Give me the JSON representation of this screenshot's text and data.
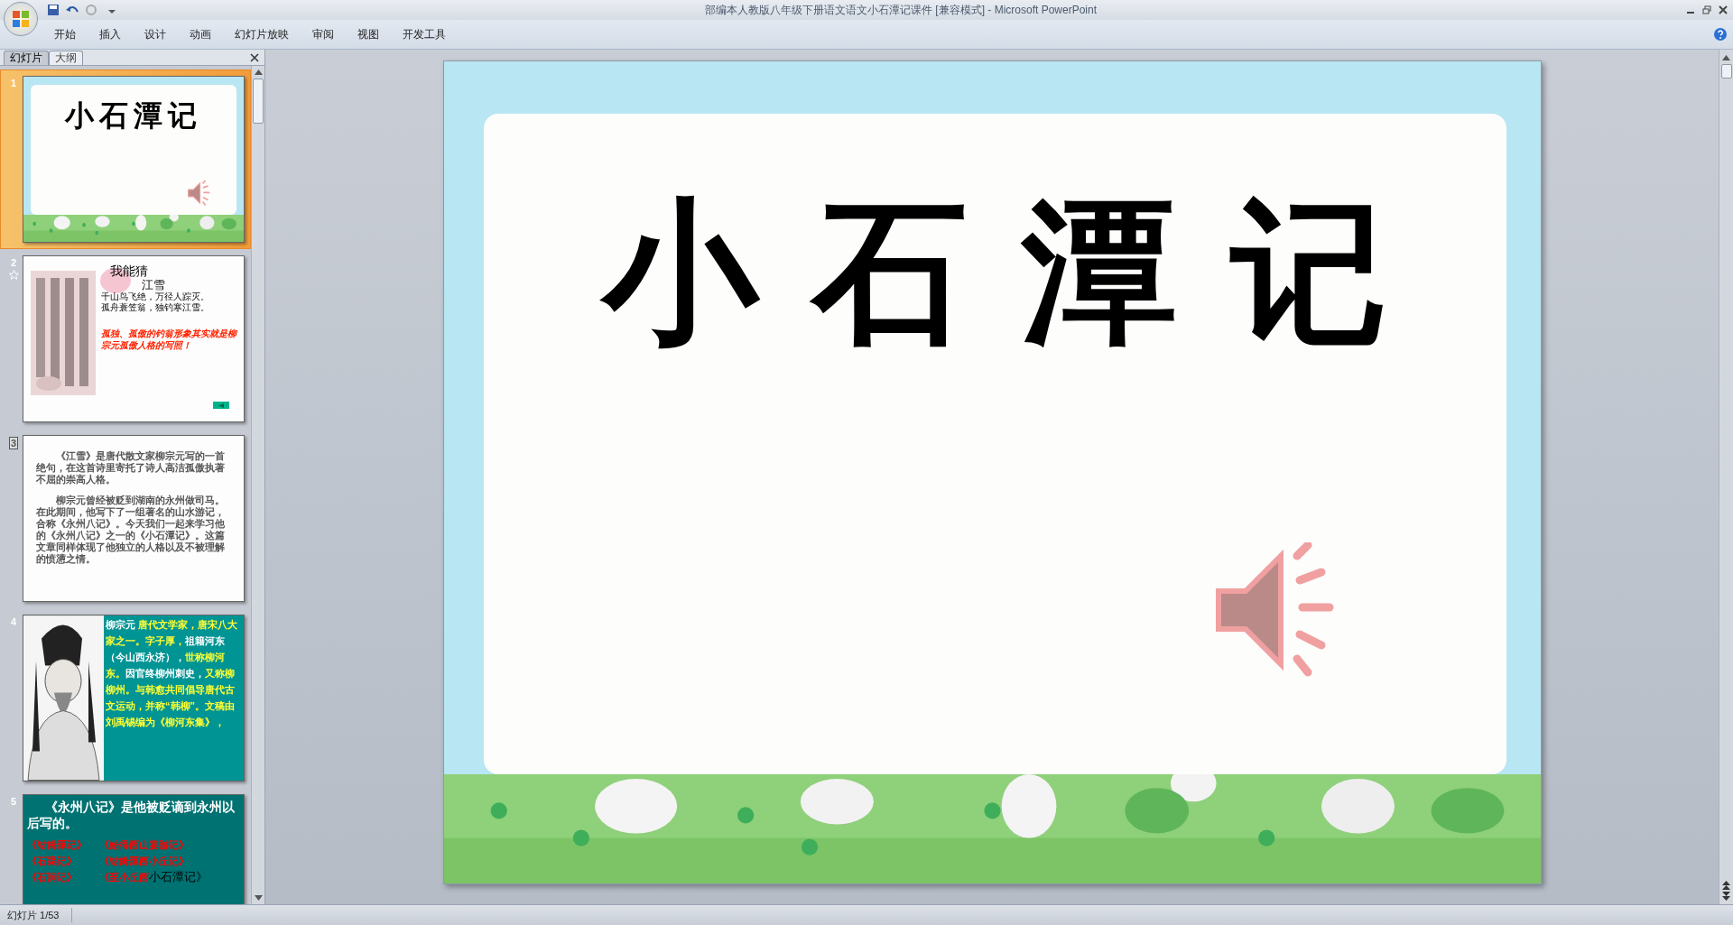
{
  "window": {
    "title": "部编本人教版八年级下册语文语文小石潭记课件 [兼容模式] - Microsoft PowerPoint"
  },
  "ribbon_tabs": [
    "开始",
    "插入",
    "设计",
    "动画",
    "幻灯片放映",
    "审阅",
    "视图",
    "开发工具"
  ],
  "panel_tabs": [
    {
      "label": "幻灯片",
      "selected": true
    },
    {
      "label": "大纲",
      "selected": false
    }
  ],
  "thumbnails": [
    {
      "number": "1",
      "kind": "title",
      "selected": true,
      "animated": false,
      "hidden": false,
      "title": "小石潭记"
    },
    {
      "number": "2",
      "kind": "poem",
      "selected": false,
      "animated": true,
      "hidden": false,
      "heading": "我能猜",
      "poem_title": "江雪",
      "lines": [
        "千山鸟飞绝，万径人踪灭。",
        "孤舟蓑笠翁，独钓寒江雪。"
      ],
      "comment": "孤独、孤傲的钓翁形象其实就是柳宗元孤傲人格的写照！"
    },
    {
      "number": "3",
      "kind": "prose",
      "selected": false,
      "animated": false,
      "hidden": true,
      "paragraphs": [
        "《江雪》是唐代散文家柳宗元写的一首绝句，在这首诗里寄托了诗人高洁孤傲执著不屈的崇高人格。",
        "柳宗元曾经被贬到湖南的永州做司马。在此期间，他写下了一组著名的山水游记，合称《永州八记》。今天我们一起来学习他的《永州八记》之一的《小石潭记》。这篇文章同样体现了他独立的人格以及不被理解的愤懑之情。"
      ]
    },
    {
      "number": "4",
      "kind": "bio",
      "selected": false,
      "animated": false,
      "hidden": false,
      "segments": [
        {
          "text": "柳宗元 ",
          "color": "#ffffff"
        },
        {
          "text": "唐代文学家，唐宋八大家之一。字子厚，",
          "color": "#ffff33"
        },
        {
          "text": "祖籍河东（今山西永济），",
          "color": "#ffffff"
        },
        {
          "text": "世称柳河东。",
          "color": "#ffff33"
        },
        {
          "text": "因官终柳州刺史，",
          "color": "#ffffff"
        },
        {
          "text": "又称柳柳州。与韩愈共同倡导唐代古文运动，并称“韩柳”。文稿由刘禹锡编为《柳河东集》，",
          "color": "#ffff33"
        }
      ]
    },
    {
      "number": "5",
      "kind": "list",
      "selected": false,
      "animated": false,
      "hidden": false,
      "intro": "《永州八记》是他被贬谪到永州以后写的。",
      "items": [
        [
          {
            "text": "《钴鉧潭记》",
            "color": "#ff0000"
          }
        ],
        [
          {
            "text": "《始得西山宴游记》",
            "color": "#ff0000"
          }
        ],
        [
          {
            "text": "《石渠记》",
            "color": "#ff0000"
          }
        ],
        [
          {
            "text": "《钴鉧潭西小丘记》",
            "color": "#ff0000"
          }
        ],
        [
          {
            "text": "《石涧记》",
            "color": "#ff0000"
          }
        ],
        [
          {
            "text": "《至小丘西",
            "color": "#ff0000"
          },
          {
            "text": "小石潭记》",
            "color": "#000000"
          }
        ]
      ]
    }
  ],
  "slide": {
    "title": "小石潭记"
  },
  "status_bar": {
    "slide_counter": "幻灯片 1/53"
  }
}
